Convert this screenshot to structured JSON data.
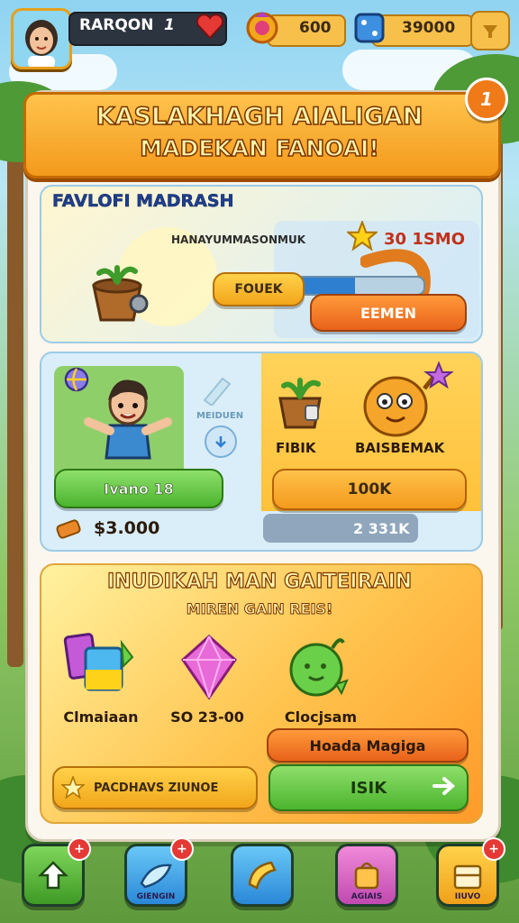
{
  "hud": {
    "player_name": "RARQON",
    "name_mark": "1",
    "coins": "600",
    "gems": "39000",
    "icons": {
      "avatar": "avatar",
      "heart": "heart-icon",
      "coin": "gear-coin-icon",
      "gem_box": "dice-icon",
      "bag": "bag-icon"
    }
  },
  "banner": {
    "title_line1": "KASLAKHAGH AIALIGAN",
    "title_line2": "MADEKAN FANOAI!",
    "corner_mark": "1"
  },
  "panel1": {
    "title": "FAVLOFI MADRASH",
    "subtitle": "HANAYUMMASONMUK",
    "reward_value": "30 1SMO",
    "input_label": "FOUEK",
    "button_label": "EEMEN",
    "progress": 0.55
  },
  "panel2": {
    "hero_button": "Ivano 18",
    "middle_label": "MEIDUEN",
    "item1_label": "FIBIK",
    "item2_label": "BAISBEMAK",
    "orange_button": "100K",
    "price": "$3.000",
    "bar_value": "2 331K"
  },
  "panel3": {
    "title": "INUDIKAH MAN GAITEIRAIN",
    "subtitle": "MIREN GAIN REIS!",
    "items": [
      {
        "icon": "ticket-items-icon",
        "label": "Clmaiaan"
      },
      {
        "icon": "pink-gem-icon",
        "label": "SO 23-00"
      },
      {
        "icon": "green-potion-icon",
        "label": "Clocjsam"
      }
    ],
    "magic_button": "Hoada Magiga",
    "left_button": "PACDHAVS ZIUNOE",
    "go_button": "ISIK"
  },
  "nav": [
    {
      "icon": "home-arrow-icon",
      "label": "",
      "badge": "+"
    },
    {
      "icon": "fish-icon",
      "label": "GIENGIN",
      "badge": "+"
    },
    {
      "icon": "horn-icon",
      "label": "",
      "badge": ""
    },
    {
      "icon": "bag-icon",
      "label": "AGIAIS",
      "badge": ""
    },
    {
      "icon": "chest-icon",
      "label": "IIUVO",
      "badge": "+"
    }
  ]
}
